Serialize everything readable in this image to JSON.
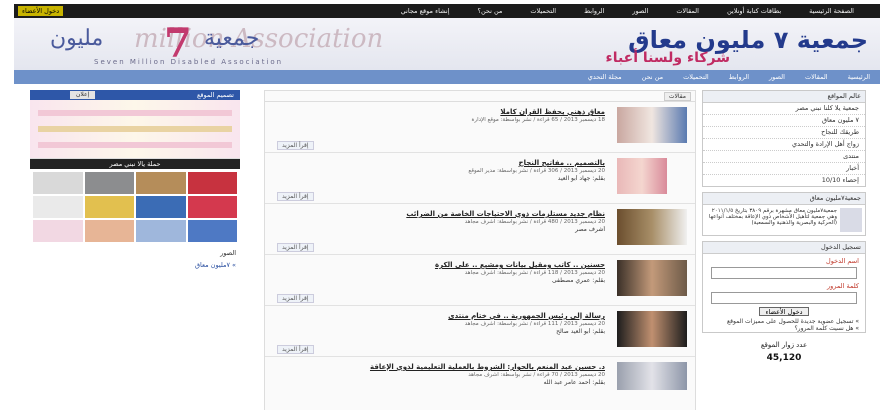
{
  "topbar": {
    "nav": [
      "الصفحة الرئيسية",
      "بطاقات كتابة أونلاين",
      "المقالات",
      "الصور",
      "الروابط",
      "التحميلات",
      "من نحن؟",
      "إنشاء موقع مجاني"
    ],
    "login": "دخول الأعضاء"
  },
  "banner": {
    "logo_ar": "جمعية",
    "logo_num": "7",
    "logo_ar2": "مليون",
    "logo_en": "Seven Million Disabled Association",
    "watermark": "million Association",
    "title": "جمعية ٧ مليون معاق",
    "subtitle": "شركاء ولسنا أعباء"
  },
  "mainnav": [
    "الرئيسية",
    "المقالات",
    "الصور",
    "الروابط",
    "التحميلات",
    "من نحن",
    "مجلة التحدي"
  ],
  "right": {
    "box1_title": "عالم المواقع",
    "items": [
      "جمعية يلا كلنا نبني مصر",
      "٧ مليون معاق",
      "طريقك للنجاح",
      "زواج أهل الإرادة والتحدي",
      "منتدى",
      "أخبار",
      "إحصاء 10/10"
    ],
    "box2_title": "جمعية٧مليون معاق",
    "box2_text": "جمعية٧مليون معاق مشهرة برقم ٣٨٠٩ بتاريخ ٢٠١١/١/٥ وهي جمعية لتأهيل الأشخاص ذوي الإعاقة بمختلف أنواعها (الحركية والبصرية والذهنية والسمعية)",
    "login_title": "تسجيل الدخول",
    "user_label": "اسم الدخول",
    "pass_label": "كلمة المرور",
    "login_button": "دخول الأعضاء",
    "register_note": "» تسجيل عضوية جديدة للحصول على مميزات الموقع",
    "forgot_note": "» هل نسيت كلمة المرور؟",
    "visitors_label": "عدد زوار الموقع",
    "visitors": "45,120"
  },
  "left": {
    "box1_title": "تصميم الموقع",
    "box1_tag": "إعلان",
    "box2_title": "حملة يالا نبني مصر",
    "footer_title": "الصور",
    "footer_link": "» ٧مليون معاق"
  },
  "middle": {
    "header": "مقالات",
    "more": "إقرأ المزيد",
    "articles": [
      {
        "title": "معاق ذهني يحفظ القرآن كاملا",
        "meta": "18 ديسمبر 2013 / 65 قراءة / نشر بواسطة: موقع الإدارة",
        "author": ""
      },
      {
        "title": "بالتصميم .. مفاتيح النجاح",
        "meta": "20 ديسمبر 2013 / 306 قراءة / نشر بواسطة: مدير الموقع",
        "author": "بقلم: جهاد أبو العيد"
      },
      {
        "title": "نظام جديد مستلزمات ذوي الاحتياجات الخاصة من الضرائب",
        "meta": "20 ديسمبر 2013 / 480 قراءة / نشر بواسطة: أشرف مجاهد",
        "author": "أشرف مصر"
      },
      {
        "title": "حسنين .. كاتب ومقيل بيانات ومشيع .. على الكرة",
        "meta": "20 ديسمبر 2013 / 118 قراءة / نشر بواسطة: أشرف مجاهد",
        "author": "بقلم: عمري مصطفى"
      },
      {
        "title": "رسالة إلى رئيس الجمهورية .. في ختام منتدى",
        "meta": "20 ديسمبر 2013 / 111 قراءة / نشر بواسطة: أشرف مجاهد",
        "author": "بقلم: أبو العيد صالح"
      },
      {
        "title": "د. حسين عبد المنعم بالحوار: الشروط بالعملية التعليمية لذوي الإعاقة",
        "meta": "20 ديسمبر 2013 / 70 قراءة / نشر بواسطة: أشرف مجاهد",
        "author": "بقلم: أحمد عامر عبد الله"
      }
    ]
  },
  "colors": {
    "topbar": "#1c1c1c",
    "nav": "#6e91c9",
    "title": "#233a8c",
    "accent": "#c02b63"
  }
}
